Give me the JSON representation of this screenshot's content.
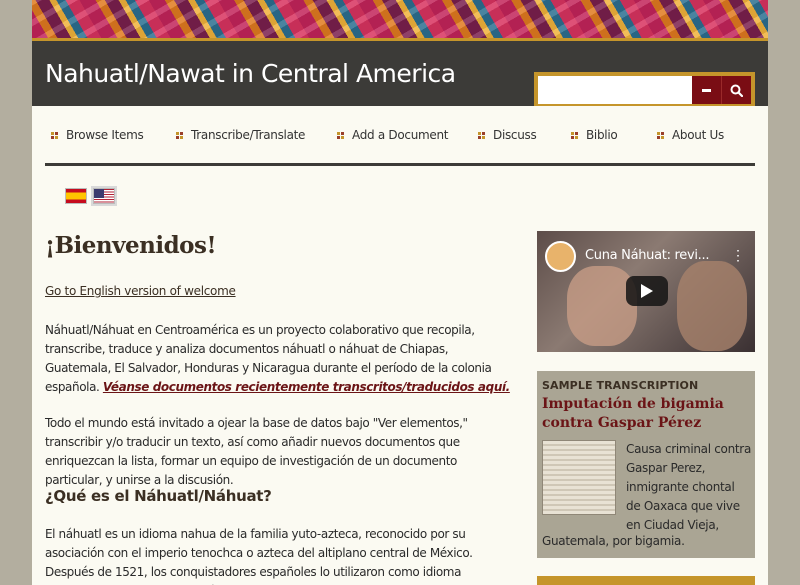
{
  "site": {
    "title": "Nahuatl/Nawat in Central America"
  },
  "search": {
    "placeholder": "",
    "menu_icon": "minus-icon",
    "submit_icon": "search-icon"
  },
  "nav": {
    "items": [
      {
        "label": "Browse Items"
      },
      {
        "label": "Transcribe/Translate"
      },
      {
        "label": "Add a Document"
      },
      {
        "label": "Discuss"
      },
      {
        "label": "Biblio"
      },
      {
        "label": "About Us"
      }
    ]
  },
  "languages": [
    {
      "name": "es",
      "icon": "spain-flag-icon"
    },
    {
      "name": "en",
      "icon": "us-flag-icon"
    }
  ],
  "main": {
    "heading": "¡Bienvenidos!",
    "english_link": "Go to English version of welcome",
    "p1_text": "Náhuatl/Náhuat en Centroamérica es un proyecto colaborativo que recopila, transcribe, traduce y analiza documentos náhuatl o náhuat de Chiapas, Guatemala, El Salvador, Honduras y Nicaragua durante el período de la colonia española. ",
    "p1_link": "Véanse documentos recientemente transcritos/traducidos aquí.",
    "p2_text": "Todo el mundo está invitado a ojear la base de datos bajo \"Ver elementos,\" transcribir y/o traducir un texto, así como añadir nuevos documentos que enriquezcan la lista, formar un equipo de investigación de un documento particular, y unirse a la discusión.",
    "subheading": "¿Qué es el Náhuatl/Náhuat?",
    "p3_text": "El náhuatl es un idioma nahua de la familia yuto-azteca, reconocido por su asociación con el imperio tenochca o azteca del altiplano central de México.  Después de 1521, los conquistadores españoles lo utilizaron como idioma transicional en toda Mesoamérica,"
  },
  "video": {
    "title": "Cuna Náhuat: revi...",
    "menu_icon": "more-vertical-icon",
    "play_icon": "play-icon"
  },
  "sample": {
    "label": "SAMPLE TRANSCRIPTION",
    "title": "Imputación de bigamia contra Gaspar Pérez",
    "desc_side": "Causa criminal contra Gaspar Perez, inmigrante chontal de Oaxaca que vive en Ciudad Vieja,",
    "desc_bottom": "Guatemala, por bigamia."
  },
  "colors": {
    "accent": "#c5952b",
    "dark": "#3c3b38",
    "maroon": "#7a0d14",
    "page_bg": "#fbfaf2"
  }
}
